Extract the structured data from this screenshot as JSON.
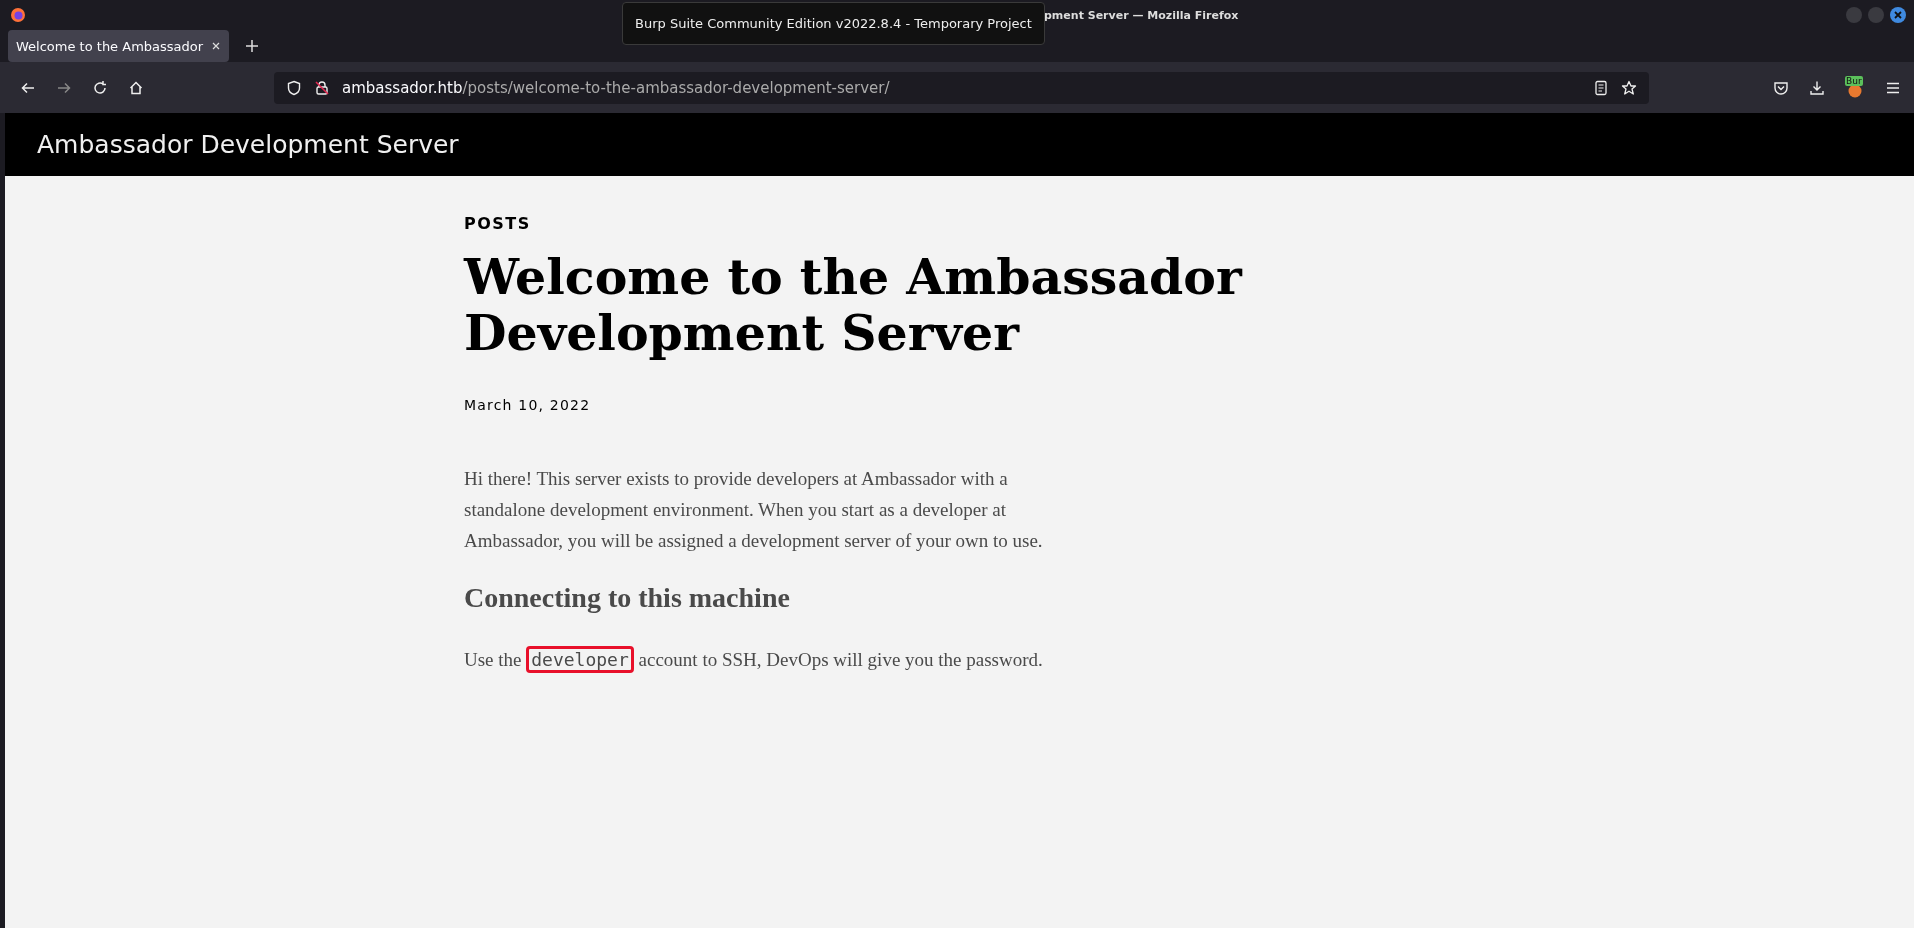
{
  "window": {
    "title_visible": "pment Server — Mozilla Firefox"
  },
  "tooltip": {
    "text": "Burp Suite Community Edition v2022.8.4 - Temporary Project"
  },
  "tabs": [
    {
      "label": "Welcome to the Ambassador",
      "selected": true
    }
  ],
  "address_bar": {
    "host": "ambassador.htb",
    "path": "/posts/welcome-to-the-ambassador-development-server/"
  },
  "burp_badge": {
    "text": "Bur"
  },
  "site": {
    "title": "Ambassador Development Server"
  },
  "post": {
    "category": "POSTS",
    "title": "Welcome to the Ambassador Development Server",
    "date": "March 10, 2022",
    "intro": "Hi there! This server exists to provide developers at Ambassador with a standalone development environment. When you start as a developer at Ambassador, you will be assigned a development server of your own to use.",
    "section_heading": "Connecting to this machine",
    "instruction_before": "Use the",
    "instruction_code": "developer",
    "instruction_after": "account to SSH, DevOps will give you the password.",
    "code_highlighted": true
  }
}
